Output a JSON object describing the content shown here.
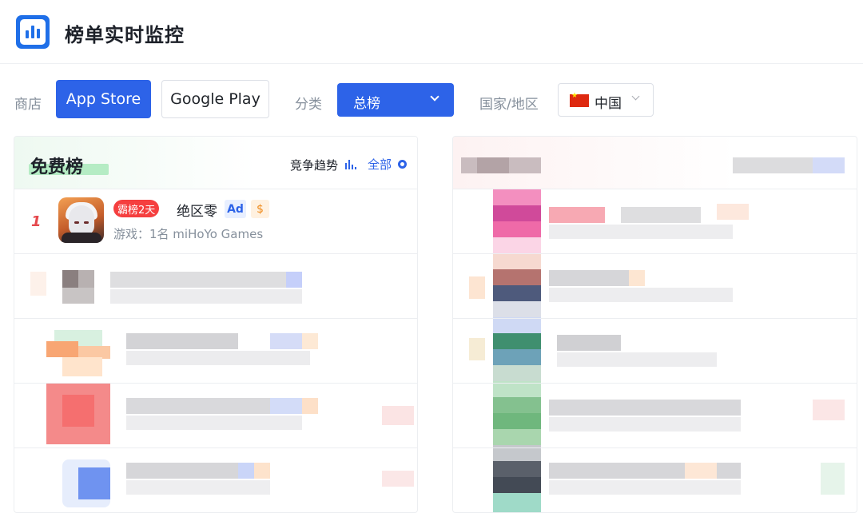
{
  "header": {
    "title": "榜单实时监控",
    "logo_icon": "bar-chart-icon"
  },
  "filters": {
    "store_label": "商店",
    "stores": [
      {
        "label": "App Store",
        "selected": true
      },
      {
        "label": "Google Play",
        "selected": false
      }
    ],
    "category_label": "分类",
    "category_value": "总榜",
    "region_label": "国家/地区",
    "region_value": "中国",
    "region_flag": "china-flag-icon"
  },
  "free_chart": {
    "title": "免费榜",
    "trend_label": "竞争趋势",
    "all_label": "全部",
    "items": [
      {
        "rank": "1",
        "tag": "霸榜2天",
        "name": "绝区零",
        "ad_badge": "Ad",
        "paid_badge": "$",
        "subtitle": "游戏：1名 miHoYo Games"
      }
    ]
  },
  "colors": {
    "accent": "#2d63e8",
    "danger": "#f53f3f",
    "highlight": "#b5ecc4"
  }
}
